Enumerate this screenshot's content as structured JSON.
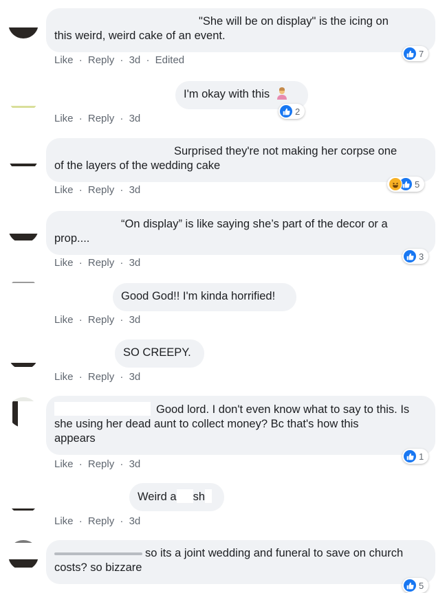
{
  "colors": {
    "like": "#1877f2",
    "haha": "#f7b125",
    "bubble": "#f0f2f5",
    "meta": "#606770"
  },
  "actions": {
    "like": "Like",
    "reply": "Reply",
    "sep": "·"
  },
  "comments": [
    {
      "text_line1": "\"She will be on display\" is the icing on",
      "text_line2": "this weird, weird cake of an event.",
      "time": "3d",
      "edited": "Edited",
      "reactions": "7"
    },
    {
      "text_line1": "I'm okay with this",
      "time": "3d",
      "reactions": "2"
    },
    {
      "text_line1": "Surprised they're not making her corpse one",
      "text_line2": "of the layers of the wedding cake",
      "time": "3d",
      "reactions": "5"
    },
    {
      "text_line1": "“On display” is like saying she’s part of the decor or a",
      "text_line2": "prop....",
      "time": "3d",
      "reactions": "3"
    },
    {
      "text_line1": "Good God!! I'm kinda horrified!",
      "time": "3d"
    },
    {
      "text_line1": "SO CREEPY.",
      "time": "3d"
    },
    {
      "text_line1": "Good lord. I don't even know what to say to this. Is",
      "text_line2": "she using her dead aunt to collect money? Bc that's how this",
      "text_line3": "appears",
      "time": "3d",
      "reactions": "1"
    },
    {
      "text_a": "Weird a",
      "text_b": "sh",
      "time": "3d"
    },
    {
      "text_line1": "so its a joint wedding and funeral to save on church",
      "text_line2": "costs? so bizzare",
      "reactions": "5"
    }
  ]
}
